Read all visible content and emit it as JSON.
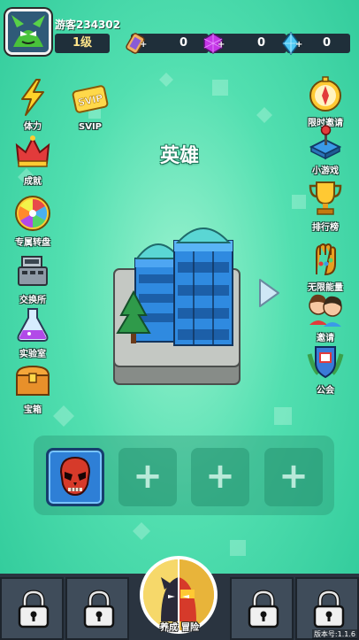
{
  "player": {
    "name": "游客234302",
    "level": "1级"
  },
  "currencies": [
    {
      "name": "scroll",
      "value": "0",
      "icon": "scroll-icon"
    },
    {
      "name": "gem",
      "value": "0",
      "icon": "purple-gem-icon"
    },
    {
      "name": "diamond",
      "value": "0",
      "icon": "diamond-icon"
    }
  ],
  "left_menu": [
    {
      "id": "stamina",
      "label": "体力",
      "icon": "lightning-icon"
    },
    {
      "id": "achievements",
      "label": "成就",
      "icon": "crown-icon"
    },
    {
      "id": "wheel",
      "label": "专属转盘",
      "icon": "wheel-icon"
    },
    {
      "id": "exchange",
      "label": "交换所",
      "icon": "cash-register-icon"
    },
    {
      "id": "lab",
      "label": "实验室",
      "icon": "flask-icon"
    },
    {
      "id": "treasure",
      "label": "宝箱",
      "icon": "chest-icon"
    }
  ],
  "svip": {
    "label": "SVIP",
    "badge_text": "SVIP"
  },
  "right_menu": [
    {
      "id": "limited-invite",
      "label": "限时邀请",
      "icon": "compass-icon"
    },
    {
      "id": "mini-game",
      "label": "小游戏",
      "icon": "joystick-icon"
    },
    {
      "id": "leaderboard",
      "label": "排行榜",
      "icon": "trophy-icon"
    },
    {
      "id": "infinite-energy",
      "label": "无限能量",
      "icon": "gauntlet-icon"
    },
    {
      "id": "invite",
      "label": "邀请",
      "icon": "friends-icon"
    },
    {
      "id": "guild",
      "label": "公会",
      "icon": "guild-crest-icon"
    }
  ],
  "hero_section": {
    "title": "英雄"
  },
  "hero_slots": [
    {
      "state": "filled",
      "hero": "red-skull-hero"
    },
    {
      "state": "empty",
      "symbol": "+"
    },
    {
      "state": "empty",
      "symbol": "+"
    },
    {
      "state": "empty",
      "symbol": "+"
    }
  ],
  "bottom_nav": {
    "center_labels": [
      "养成",
      "冒险"
    ],
    "locked_tabs": 4
  },
  "version": "版本号:1.1.6",
  "colors": {
    "background": "#52dfb0",
    "bar": "#2a3440",
    "tab": "#3f4c5a",
    "slot_blue": "#2e7fd6"
  }
}
